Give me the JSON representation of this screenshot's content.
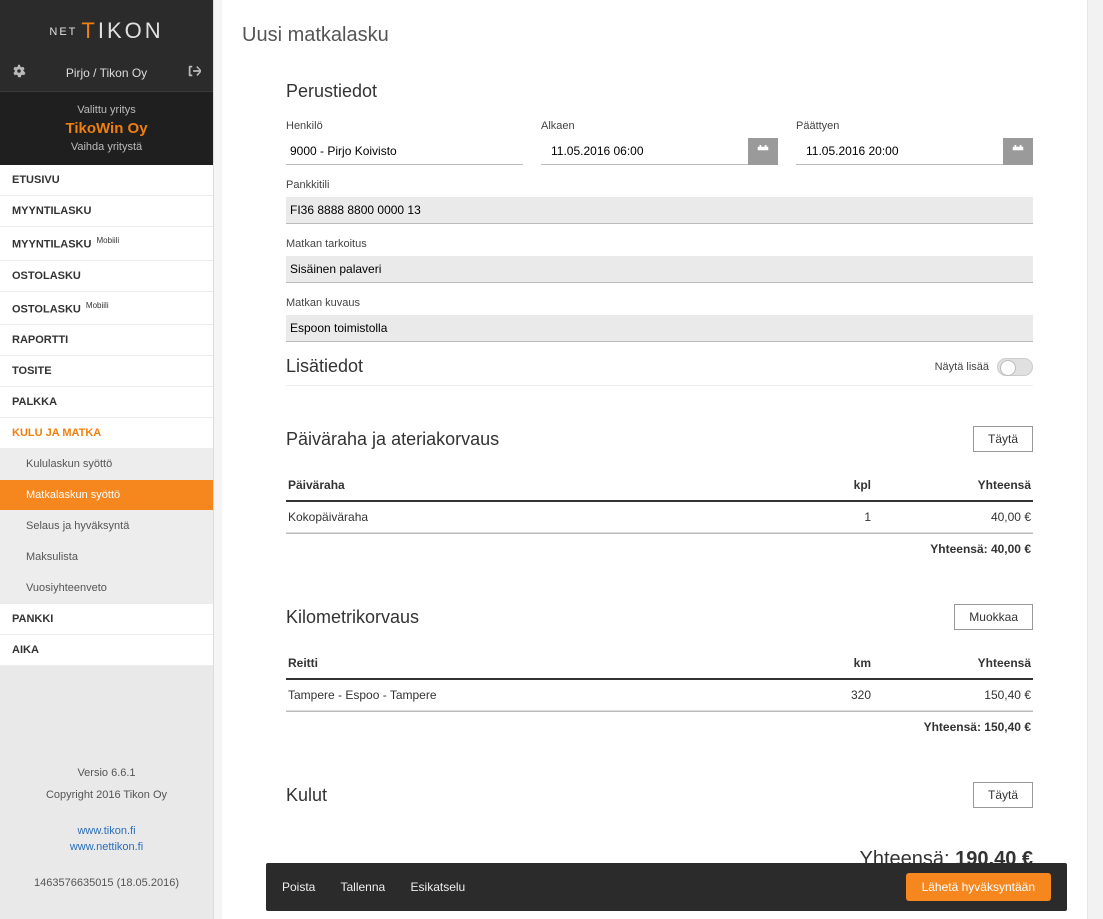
{
  "brand": {
    "net": "NET",
    "name_pre": "T",
    "name_rest": "IKON"
  },
  "user_line": "Pirjo / Tikon Oy",
  "company": {
    "selected_label": "Valittu yritys",
    "name": "TikoWin Oy",
    "change_label": "Vaihda yritystä"
  },
  "nav": {
    "etusivu": "ETUSIVU",
    "myyntilasku": "MYYNTILASKU",
    "myyntilasku_m": "MYYNTILASKU",
    "ostolasku": "OSTOLASKU",
    "ostolasku_m": "OSTOLASKU",
    "raportti": "RAPORTTI",
    "tosite": "TOSITE",
    "palkka": "PALKKA",
    "kulu": "KULU JA MATKA",
    "kulu_sub": {
      "kulu_syotto": "Kululaskun syöttö",
      "matka_syotto": "Matkalaskun syöttö",
      "selaus": "Selaus ja hyväksyntä",
      "maksulista": "Maksulista",
      "vuosi": "Vuosiyhteenveto"
    },
    "pankki": "PANKKI",
    "aika": "AIKA",
    "mobiili_sup": "Mobiili"
  },
  "footer": {
    "versio": "Versio 6.6.1",
    "copyright": "Copyright 2016 Tikon Oy",
    "link1": "www.tikon.fi",
    "link2": "www.nettikon.fi",
    "stamp": "1463576635015 (18.05.2016)"
  },
  "page": {
    "title": "Uusi matkalasku",
    "perustiedot": {
      "heading": "Perustiedot",
      "henkilo_label": "Henkilö",
      "henkilo_value": "9000 - Pirjo Koivisto",
      "alkaen_label": "Alkaen",
      "alkaen_value": "11.05.2016 06:00",
      "paattyy_label": "Päättyen",
      "paattyy_value": "11.05.2016 20:00",
      "pankkitili_label": "Pankkitili",
      "pankkitili_value": "FI36 8888 8800 0000 13",
      "tarkoitus_label": "Matkan tarkoitus",
      "tarkoitus_value": "Sisäinen palaveri",
      "kuvaus_label": "Matkan kuvaus",
      "kuvaus_value": "Espoon toimistolla"
    },
    "lisatiedot": {
      "heading": "Lisätiedot",
      "toggle_label": "Näytä lisää"
    },
    "paivaraha": {
      "heading": "Päiväraha ja ateriakorvaus",
      "button": "Täytä",
      "col1": "Päiväraha",
      "col2": "kpl",
      "col3": "Yhteensä",
      "row_name": "Kokopäiväraha",
      "row_kpl": "1",
      "row_sum": "40,00 €",
      "total_label": "Yhteensä: 40,00 €"
    },
    "km": {
      "heading": "Kilometrikorvaus",
      "button": "Muokkaa",
      "col1": "Reitti",
      "col2": "km",
      "col3": "Yhteensä",
      "row_name": "Tampere - Espoo - Tampere",
      "row_km": "320",
      "row_sum": "150,40 €",
      "total_label": "Yhteensä: 150,40 €"
    },
    "kulut": {
      "heading": "Kulut",
      "button": "Täytä"
    },
    "grand": {
      "label": "Yhteensä: ",
      "amount": "190,40 €"
    },
    "actions": {
      "poista": "Poista",
      "tallenna": "Tallenna",
      "esikatselu": "Esikatselu",
      "laheta": "Lähetä hyväksyntään"
    }
  },
  "chart_data": {
    "type": "table",
    "tables": [
      {
        "title": "Päiväraha ja ateriakorvaus",
        "columns": [
          "Päiväraha",
          "kpl",
          "Yhteensä"
        ],
        "rows": [
          [
            "Kokopäiväraha",
            1,
            40.0
          ]
        ],
        "total": 40.0,
        "currency": "€"
      },
      {
        "title": "Kilometrikorvaus",
        "columns": [
          "Reitti",
          "km",
          "Yhteensä"
        ],
        "rows": [
          [
            "Tampere - Espoo - Tampere",
            320,
            150.4
          ]
        ],
        "total": 150.4,
        "currency": "€"
      }
    ],
    "grand_total": 190.4,
    "currency": "€"
  }
}
